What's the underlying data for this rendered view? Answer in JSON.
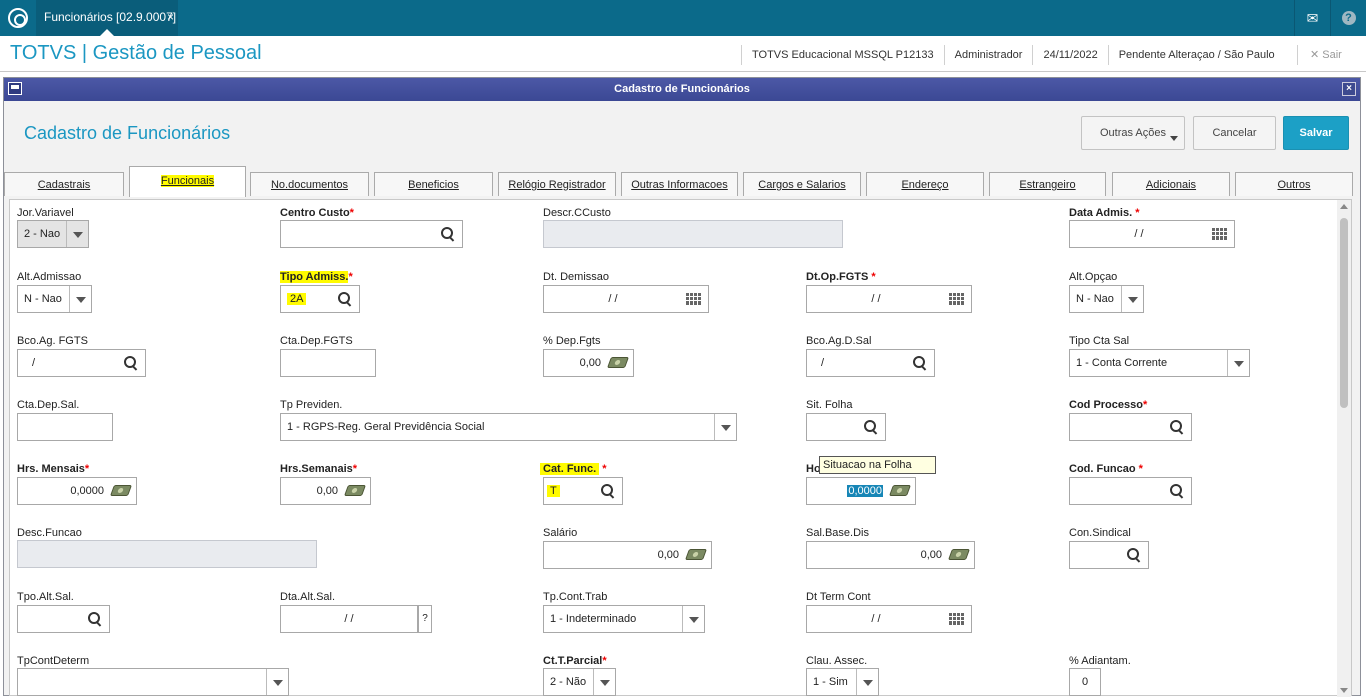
{
  "topbar": {
    "tab_label": "Funcionários [02.9.0007]",
    "tab_close": "×"
  },
  "header": {
    "app_title": "TOTVS | Gestão de Pessoal",
    "environment": "TOTVS Educacional MSSQL P12133",
    "user": "Administrador",
    "date": "24/11/2022",
    "status": "Pendente Alteraçao / São Paulo",
    "exit_label": "Sair"
  },
  "dialog": {
    "window_title": "Cadastro de Funcionários",
    "form_title": "Cadastro de Funcionários",
    "buttons": {
      "actions": "Outras Ações",
      "cancel": "Cancelar",
      "save": "Salvar"
    },
    "tabs": [
      "Cadastrais",
      "Funcionais",
      "No.documentos",
      "Beneficios",
      "Relógio Registrador",
      "Outras Informacoes",
      "Cargos e Salarios",
      "Endereço",
      "Estrangeiro",
      "Adicionais",
      "Outros"
    ],
    "active_tab": "Funcionais"
  },
  "fields": {
    "jor_variavel": {
      "label": "Jor.Variavel",
      "value": "2 - Nao"
    },
    "centro_custo": {
      "label": "Centro Custo",
      "required": "*",
      "value": ""
    },
    "descr_ccusto": {
      "label": "Descr.CCusto",
      "value": ""
    },
    "data_admis": {
      "label": "Data Admis.",
      "required": "*",
      "value": "/ /"
    },
    "alt_admissao": {
      "label": "Alt.Admissao",
      "value": "N - Nao"
    },
    "tipo_admis": {
      "label": "Tipo Admiss.",
      "required": "*",
      "value": "2A"
    },
    "dt_demissao": {
      "label": "Dt. Demissao",
      "value": "/ /"
    },
    "dt_op_fgts": {
      "label": "Dt.Op.FGTS",
      "required": "*",
      "value": "/ /"
    },
    "alt_opcao": {
      "label": "Alt.Opçao",
      "value": "N - Nao"
    },
    "bco_ag_fgts": {
      "label": "Bco.Ag. FGTS",
      "value": "/"
    },
    "cta_dep_fgts": {
      "label": "Cta.Dep.FGTS",
      "value": ""
    },
    "pct_dep_fgts": {
      "label": "% Dep.Fgts",
      "value": "0,00"
    },
    "bco_ag_d_sal": {
      "label": "Bco.Ag.D.Sal",
      "value": "/"
    },
    "tipo_cta_sal": {
      "label": "Tipo Cta Sal",
      "value": "1 - Conta Corrente"
    },
    "cta_dep_sal": {
      "label": "Cta.Dep.Sal.",
      "value": ""
    },
    "tp_previden": {
      "label": "Tp Previden.",
      "value": "1 - RGPS-Reg. Geral Previdência Social"
    },
    "sit_folha": {
      "label": "Sit. Folha",
      "value": ""
    },
    "cod_processo": {
      "label": "Cod Processo",
      "required": "*",
      "value": ""
    },
    "hrs_mensais": {
      "label": "Hrs. Mensais",
      "required": "*",
      "value": "0,0000"
    },
    "hrs_semanais": {
      "label": "Hrs.Semanais",
      "required": "*",
      "value": "0,00"
    },
    "cat_func": {
      "label": "Cat. Func.",
      "required": "*",
      "value": "T"
    },
    "hrs_dia": {
      "label": "Ho",
      "value": "0,0000"
    },
    "cod_funcao": {
      "label": "Cod. Funcao",
      "required": "*",
      "value": ""
    },
    "desc_funcao": {
      "label": "Desc.Funcao",
      "value": ""
    },
    "salario": {
      "label": "Salário",
      "value": "0,00"
    },
    "sal_base_dis": {
      "label": "Sal.Base.Dis",
      "value": "0,00"
    },
    "con_sindical": {
      "label": "Con.Sindical",
      "value": ""
    },
    "tpo_alt_sal": {
      "label": "Tpo.Alt.Sal.",
      "value": ""
    },
    "dta_alt_sal": {
      "label": "Dta.Alt.Sal.",
      "value": "/ /",
      "help": "?"
    },
    "tp_cont_trab": {
      "label": "Tp.Cont.Trab",
      "value": "1 - Indeterminado"
    },
    "dt_term_cont": {
      "label": "Dt Term Cont",
      "value": "/ /"
    },
    "tp_cont_determ": {
      "label": "TpContDeterm",
      "value": ""
    },
    "ct_t_parcial": {
      "label": "Ct.T.Parcial",
      "required": "*",
      "value": "2 - Não"
    },
    "clau_assec": {
      "label": "Clau. Assec.",
      "value": "1 - Sim"
    },
    "pct_adiantam": {
      "label": "% Adiantam.",
      "value": "0"
    }
  },
  "tooltip": {
    "text": "Situacao na Folha"
  }
}
